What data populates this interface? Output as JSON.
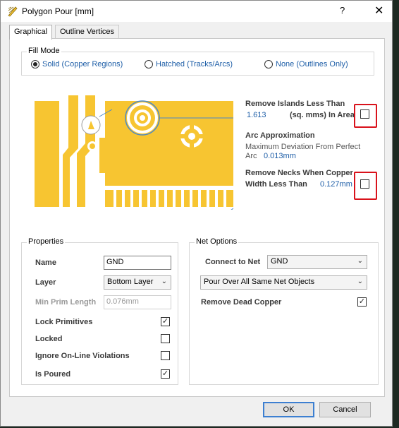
{
  "window": {
    "title": "Polygon Pour [mm]",
    "help": "?",
    "close": "✕"
  },
  "tabs": [
    {
      "label": "Graphical",
      "active": true
    },
    {
      "label": "Outline Vertices",
      "active": false
    }
  ],
  "fill_mode": {
    "title": "Fill Mode",
    "options": [
      {
        "label": "Solid (Copper Regions)",
        "selected": true
      },
      {
        "label": "Hatched (Tracks/Arcs)",
        "selected": false
      },
      {
        "label": "None (Outlines Only)",
        "selected": false
      }
    ]
  },
  "preview": {
    "remove_islands": {
      "title": "Remove Islands Less Than",
      "value": "1.613",
      "unit": "(sq. mms) In Area",
      "checked": false
    },
    "arc_approx": {
      "title": "Arc Approximation",
      "desc": "Maximum Deviation From Perfect",
      "arc_label": "Arc",
      "value": "0.013mm"
    },
    "remove_necks": {
      "title": "Remove Necks When Copper",
      "width_label": "Width Less Than",
      "value": "0.127mm",
      "checked": false
    }
  },
  "properties": {
    "title": "Properties",
    "name_label": "Name",
    "name_value": "GND",
    "layer_label": "Layer",
    "layer_value": "Bottom Layer",
    "min_prim_label": "Min Prim Length",
    "min_prim_value": "0.076mm",
    "checks": [
      {
        "label": "Lock Primitives",
        "checked": true
      },
      {
        "label": "Locked",
        "checked": false
      },
      {
        "label": "Ignore On-Line Violations",
        "checked": false
      },
      {
        "label": "Is Poured",
        "checked": true
      }
    ]
  },
  "net_options": {
    "title": "Net Options",
    "connect_label": "Connect to Net",
    "connect_value": "GND",
    "pour_over_value": "Pour Over All Same Net Objects",
    "remove_dead_label": "Remove Dead Copper",
    "remove_dead_checked": true
  },
  "footer": {
    "ok": "OK",
    "cancel": "Cancel"
  },
  "colors": {
    "copper": "#f7c531",
    "highlight": "#d9121b",
    "link": "#1f5fa8"
  }
}
